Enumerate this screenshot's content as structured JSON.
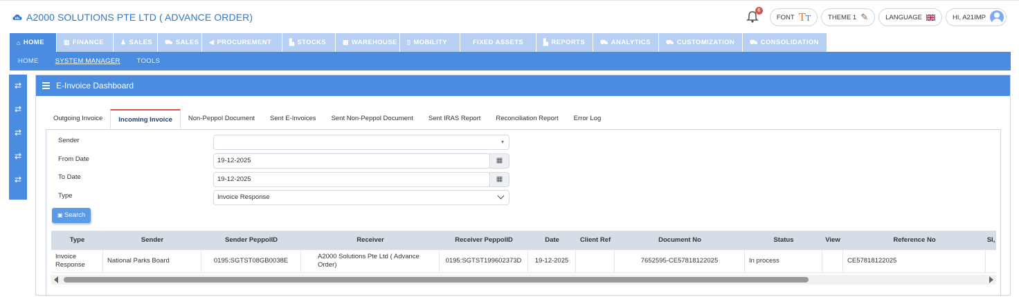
{
  "header": {
    "company": "A2000 SOLUTIONS PTE LTD ( ADVANCE ORDER)",
    "notification_count": "6",
    "font_label": "FONT",
    "theme_label": "THEME 1",
    "language_label": "LANGUAGE",
    "user_greeting": "HI, A21IMP"
  },
  "menu": {
    "items": [
      {
        "label": "HOME",
        "icon": "home-icon"
      },
      {
        "label": "FINANCE",
        "icon": "bank-icon"
      },
      {
        "label": "SALES",
        "icon": "users-icon"
      },
      {
        "label": "SALES",
        "icon": "cart-icon"
      },
      {
        "label": "PROCUREMENT",
        "icon": "bullhorn-icon"
      },
      {
        "label": "STOCKS",
        "icon": "bar-chart-icon"
      },
      {
        "label": "WAREHOUSE",
        "icon": "warehouse-icon"
      },
      {
        "label": "MOBILITY",
        "icon": "mobile-icon"
      },
      {
        "label": "FIXED ASSETS",
        "icon": ""
      },
      {
        "label": "REPORTS",
        "icon": "bar-chart-icon"
      },
      {
        "label": "ANALYTICS",
        "icon": "cart-icon"
      },
      {
        "label": "CUSTOMIZATION",
        "icon": "cart-icon"
      },
      {
        "label": "CONSOLIDATION",
        "icon": "cart-icon"
      }
    ]
  },
  "submenu": {
    "home": "HOME",
    "system_manager": "SYSTEM MANAGER",
    "tools": "TOOLS"
  },
  "panel": {
    "title": "E-Invoice Dashboard"
  },
  "tabs": [
    "Outgoing Invoice",
    "Incoming Invoice",
    "Non-Peppol Document",
    "Sent E-Invoices",
    "Sent Non-Peppol Document",
    "Sent IRAS Report",
    "Reconciliation Report",
    "Error Log"
  ],
  "form": {
    "sender_label": "Sender",
    "sender_value": "",
    "from_date_label": "From Date",
    "from_date_value": "19-12-2025",
    "to_date_label": "To Date",
    "to_date_value": "19-12-2025",
    "type_label": "Type",
    "type_value": "Invoice Response",
    "search_label": "Search"
  },
  "table": {
    "columns": [
      "Type",
      "Sender",
      "Sender PeppolID",
      "Receiver",
      "Receiver PeppolID",
      "Date",
      "Client Ref",
      "Document No",
      "Status",
      "View",
      "Reference No",
      "SI,"
    ],
    "rows": [
      {
        "type": "Invoice Response",
        "sender": "National Parks Board",
        "sender_peppol": "0195:SGTST08GB0038E",
        "receiver": "A2000 Solutions Pte Ltd ( Advance Order)",
        "receiver_peppol": "0195:SGTST199602373D",
        "date": "19-12-2025",
        "client_ref": "",
        "document_no": "7652595-CE57818122025",
        "status": "In process",
        "view": "",
        "reference_no": "CE57818122025",
        "extra": ""
      }
    ]
  },
  "colors": {
    "primary": "#4a8de0",
    "menu_inactive": "#b7cff2",
    "active_tab_border": "#d9534f",
    "brand_text": "#2d77d0"
  }
}
